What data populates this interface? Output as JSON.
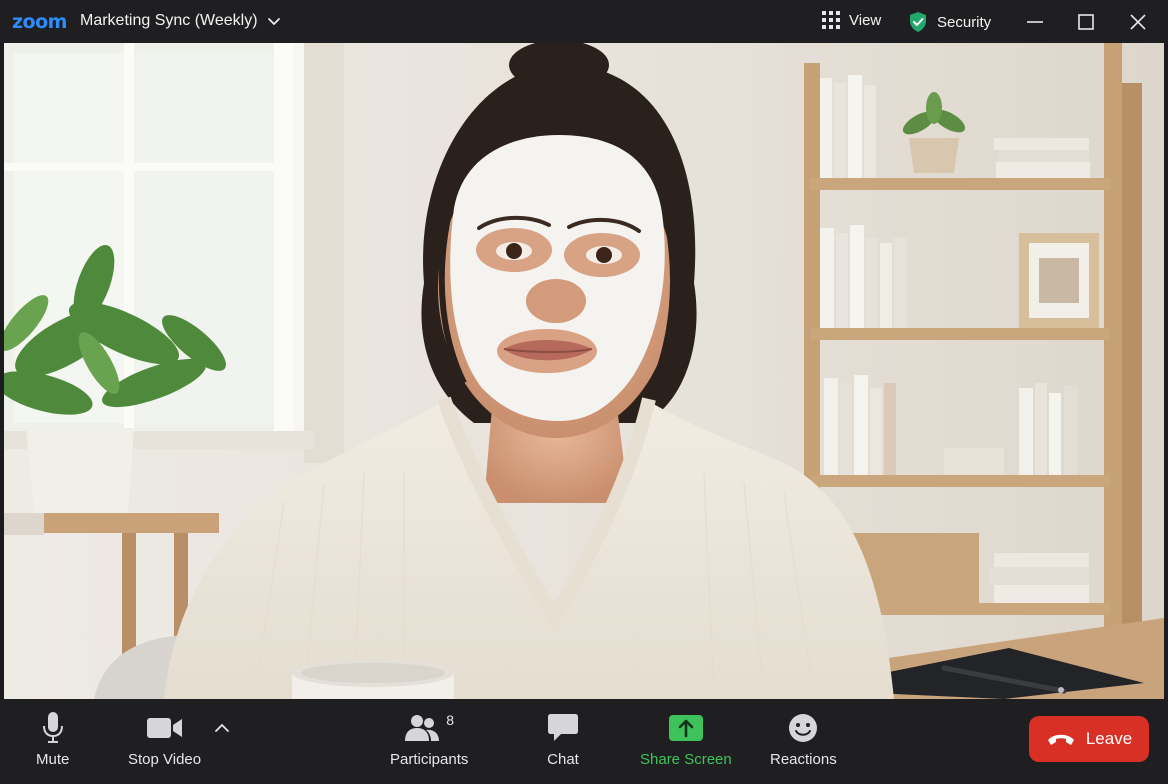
{
  "app": {
    "logo": "zoom",
    "meeting_title": "Marketing Sync (Weekly)"
  },
  "titlebar": {
    "view_label": "View",
    "security_label": "Security"
  },
  "colors": {
    "brand_blue": "#2d8cff",
    "security_green": "#23a86b",
    "share_green": "#3fc25a",
    "leave_red": "#d93025"
  },
  "toolbar": {
    "mute_label": "Mute",
    "stop_video_label": "Stop Video",
    "participants_label": "Participants",
    "participants_count": "8",
    "chat_label": "Chat",
    "share_screen_label": "Share Screen",
    "reactions_label": "Reactions",
    "leave_label": "Leave"
  },
  "icons": {
    "microphone": "microphone-icon",
    "camera": "video-camera-icon",
    "participants": "participants-icon",
    "chat": "chat-bubble-icon",
    "share": "share-screen-icon",
    "reactions": "smiley-icon",
    "leave": "phone-hangup-icon",
    "view": "grid-icon",
    "security": "shield-check-icon"
  }
}
